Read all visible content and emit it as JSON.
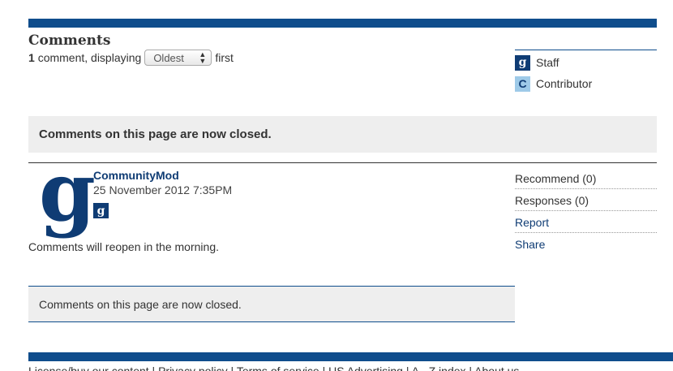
{
  "comments": {
    "heading": "Comments",
    "count": "1",
    "count_text": "comment, displaying",
    "sort": {
      "selected": "Oldest"
    },
    "suffix": "first"
  },
  "legend": {
    "items": [
      {
        "badge": "g",
        "label": "Staff"
      },
      {
        "badge": "C",
        "label": "Contributor"
      }
    ]
  },
  "closed_notice": "Comments on this page are now closed.",
  "comment": {
    "avatar_letter": "g",
    "author": "CommunityMod",
    "timestamp": "25 November 2012 7:35PM",
    "badge": "g",
    "body": "Comments will reopen in the morning.",
    "actions": {
      "recommend": "Recommend (0)",
      "responses": "Responses (0)",
      "report": "Report",
      "share": "Share"
    }
  },
  "closed_box": "Comments on this page are now closed.",
  "footer": {
    "links_text": "License/buy our content | Privacy policy | Terms of service | US Advertising | A - Z index | About us"
  },
  "colors": {
    "brand": "#0f4d8c",
    "staff_badge": "#0f3c74",
    "contributor_badge": "#9ecae8",
    "banner_bg": "#eeeeee"
  }
}
